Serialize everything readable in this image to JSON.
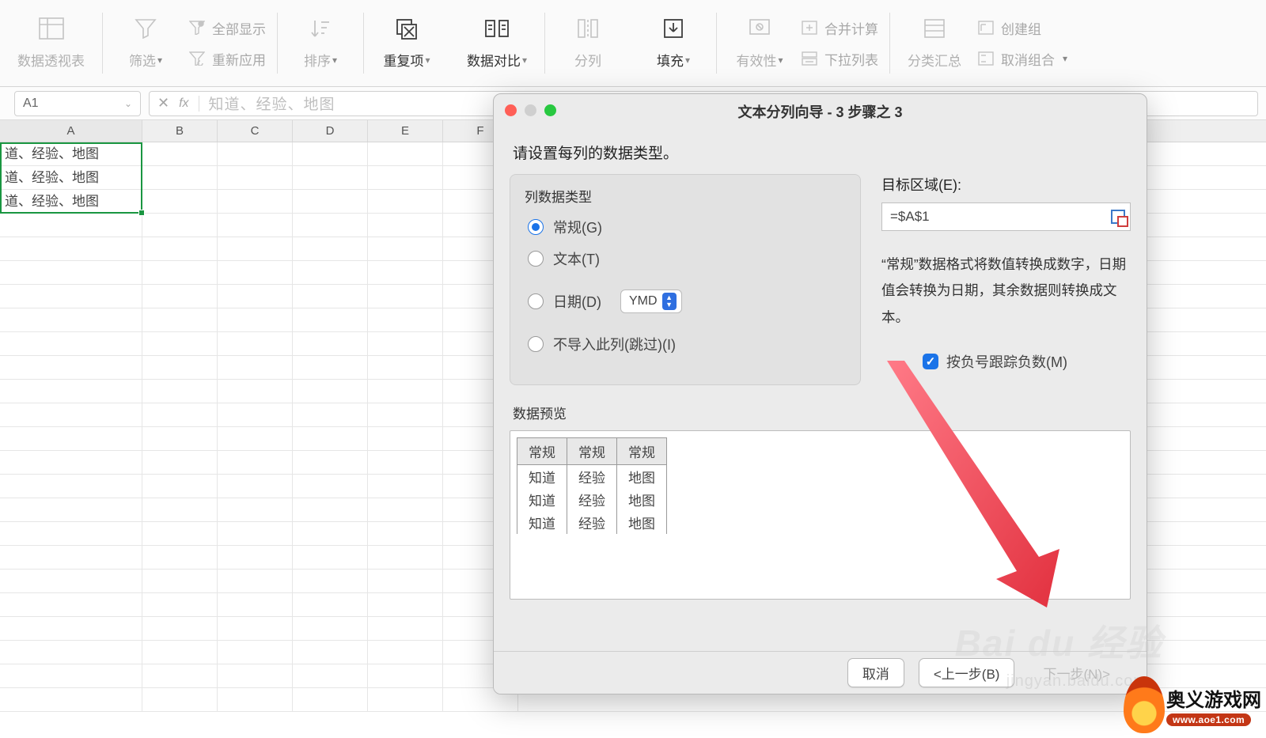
{
  "ribbon": {
    "pivot": "数据透视表",
    "filter": "筛选",
    "show_all": "全部显示",
    "reapply": "重新应用",
    "sort": "排序",
    "dedup": "重复项",
    "compare": "数据对比",
    "split_col": "分列",
    "fill": "填充",
    "validate": "有效性",
    "consolidate": "合并计算",
    "dropdown_list": "下拉列表",
    "subtotal": "分类汇总",
    "group": "创建组",
    "ungroup": "取消组合"
  },
  "formula_bar": {
    "cell_ref": "A1",
    "fx": "fx",
    "content": "知道、经验、地图"
  },
  "columns": [
    "A",
    "B",
    "C",
    "D",
    "E",
    "F"
  ],
  "cells": {
    "A": [
      "道、经验、地图",
      "道、经验、地图",
      "道、经验、地图"
    ]
  },
  "dialog": {
    "title": "文本分列向导 - 3 步骤之 3",
    "instruction": "请设置每列的数据类型。",
    "data_type_group": "列数据类型",
    "radio_general": "常规(G)",
    "radio_text": "文本(T)",
    "radio_date": "日期(D)",
    "date_format": "YMD",
    "radio_skip": "不导入此列(跳过)(I)",
    "target_label": "目标区域(E):",
    "target_value": "=$A$1",
    "desc": "“常规”数据格式将数值转换成数字，日期值会转换为日期，其余数据则转换成文本。",
    "checkbox_neg": "按负号跟踪负数(M)",
    "preview_label": "数据预览",
    "preview_headers": [
      "常规",
      "常规",
      "常规"
    ],
    "preview_rows": [
      [
        "知道",
        "经验",
        "地图"
      ],
      [
        "知道",
        "经验",
        "地图"
      ],
      [
        "知道",
        "经验",
        "地图"
      ]
    ],
    "btn_cancel": "取消",
    "btn_prev": "<上一步(B)",
    "btn_next": "下一步(N)>"
  },
  "watermark": {
    "baidu": "Bai du 经验",
    "baidu_sub": "jingyan.baidu.com",
    "site_cn": "奥义游戏网",
    "site_en": "www.aoe1.com"
  }
}
